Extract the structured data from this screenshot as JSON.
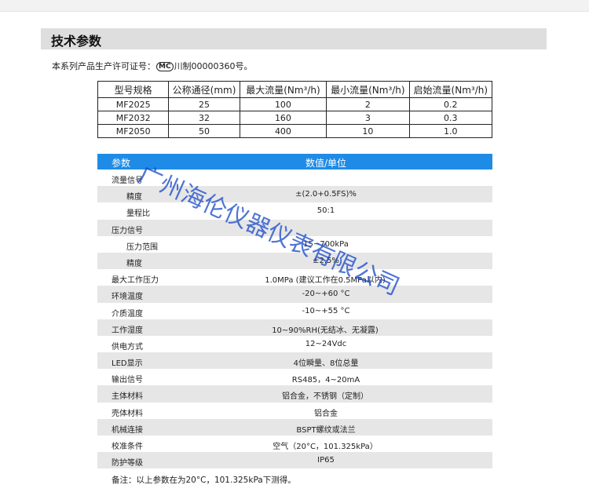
{
  "section": {
    "title": "技术参数"
  },
  "license": {
    "prefix": "本系列产品生产许可证号：",
    "mark": "MC",
    "suffix": "川制00000360号。"
  },
  "spec_table": {
    "headers": [
      "型号规格",
      "公称通径(mm)",
      "最大流量(Nm³/h)",
      "最小流量(Nm³/h)",
      "启始流量(Nm³/h)"
    ],
    "rows": [
      [
        "MF2025",
        "25",
        "100",
        "2",
        "0.2"
      ],
      [
        "MF2032",
        "32",
        "160",
        "3",
        "0.3"
      ],
      [
        "MF2050",
        "50",
        "400",
        "10",
        "1.0"
      ]
    ]
  },
  "params": {
    "header": {
      "param": "参数",
      "value": "数值/单位"
    },
    "rows": [
      {
        "label": "流量信号",
        "value": ""
      },
      {
        "label": "精度",
        "value": "±(2.0+0.5FS)%"
      },
      {
        "label": "量程比",
        "value": "50:1"
      },
      {
        "label": "压力信号",
        "value": ""
      },
      {
        "label": "压力范围",
        "value": "15~700kPa"
      },
      {
        "label": "精度",
        "value": "±2.5%"
      },
      {
        "label": "最大工作压力",
        "value": "1.0MPa (建议工作在0.5MPa以内)"
      },
      {
        "label": "环境温度",
        "value": "-20~+60 °C"
      },
      {
        "label": "介质温度",
        "value": "-10~+55 °C"
      },
      {
        "label": "工作湿度",
        "value": "10~90%RH(无结冰、无凝露)"
      },
      {
        "label": "供电方式",
        "value": "12~24Vdc"
      },
      {
        "label": "LED显示",
        "value": "4位瞬量、8位总量"
      },
      {
        "label": "输出信号",
        "value": "RS485，4~20mA"
      },
      {
        "label": "主体材料",
        "value": "铝合金，不锈钢（定制）"
      },
      {
        "label": "壳体材料",
        "value": "铝合金"
      },
      {
        "label": "机械连接",
        "value": "BSPT螺纹或法兰"
      },
      {
        "label": "校准条件",
        "value": "空气（20°C，101.325kPa）"
      },
      {
        "label": "防护等级",
        "value": "IP65"
      }
    ]
  },
  "note": "备注：以上参数在为20°C，101.325kPa下测得。",
  "watermark": "广州海伦仪器仪表有限公司"
}
